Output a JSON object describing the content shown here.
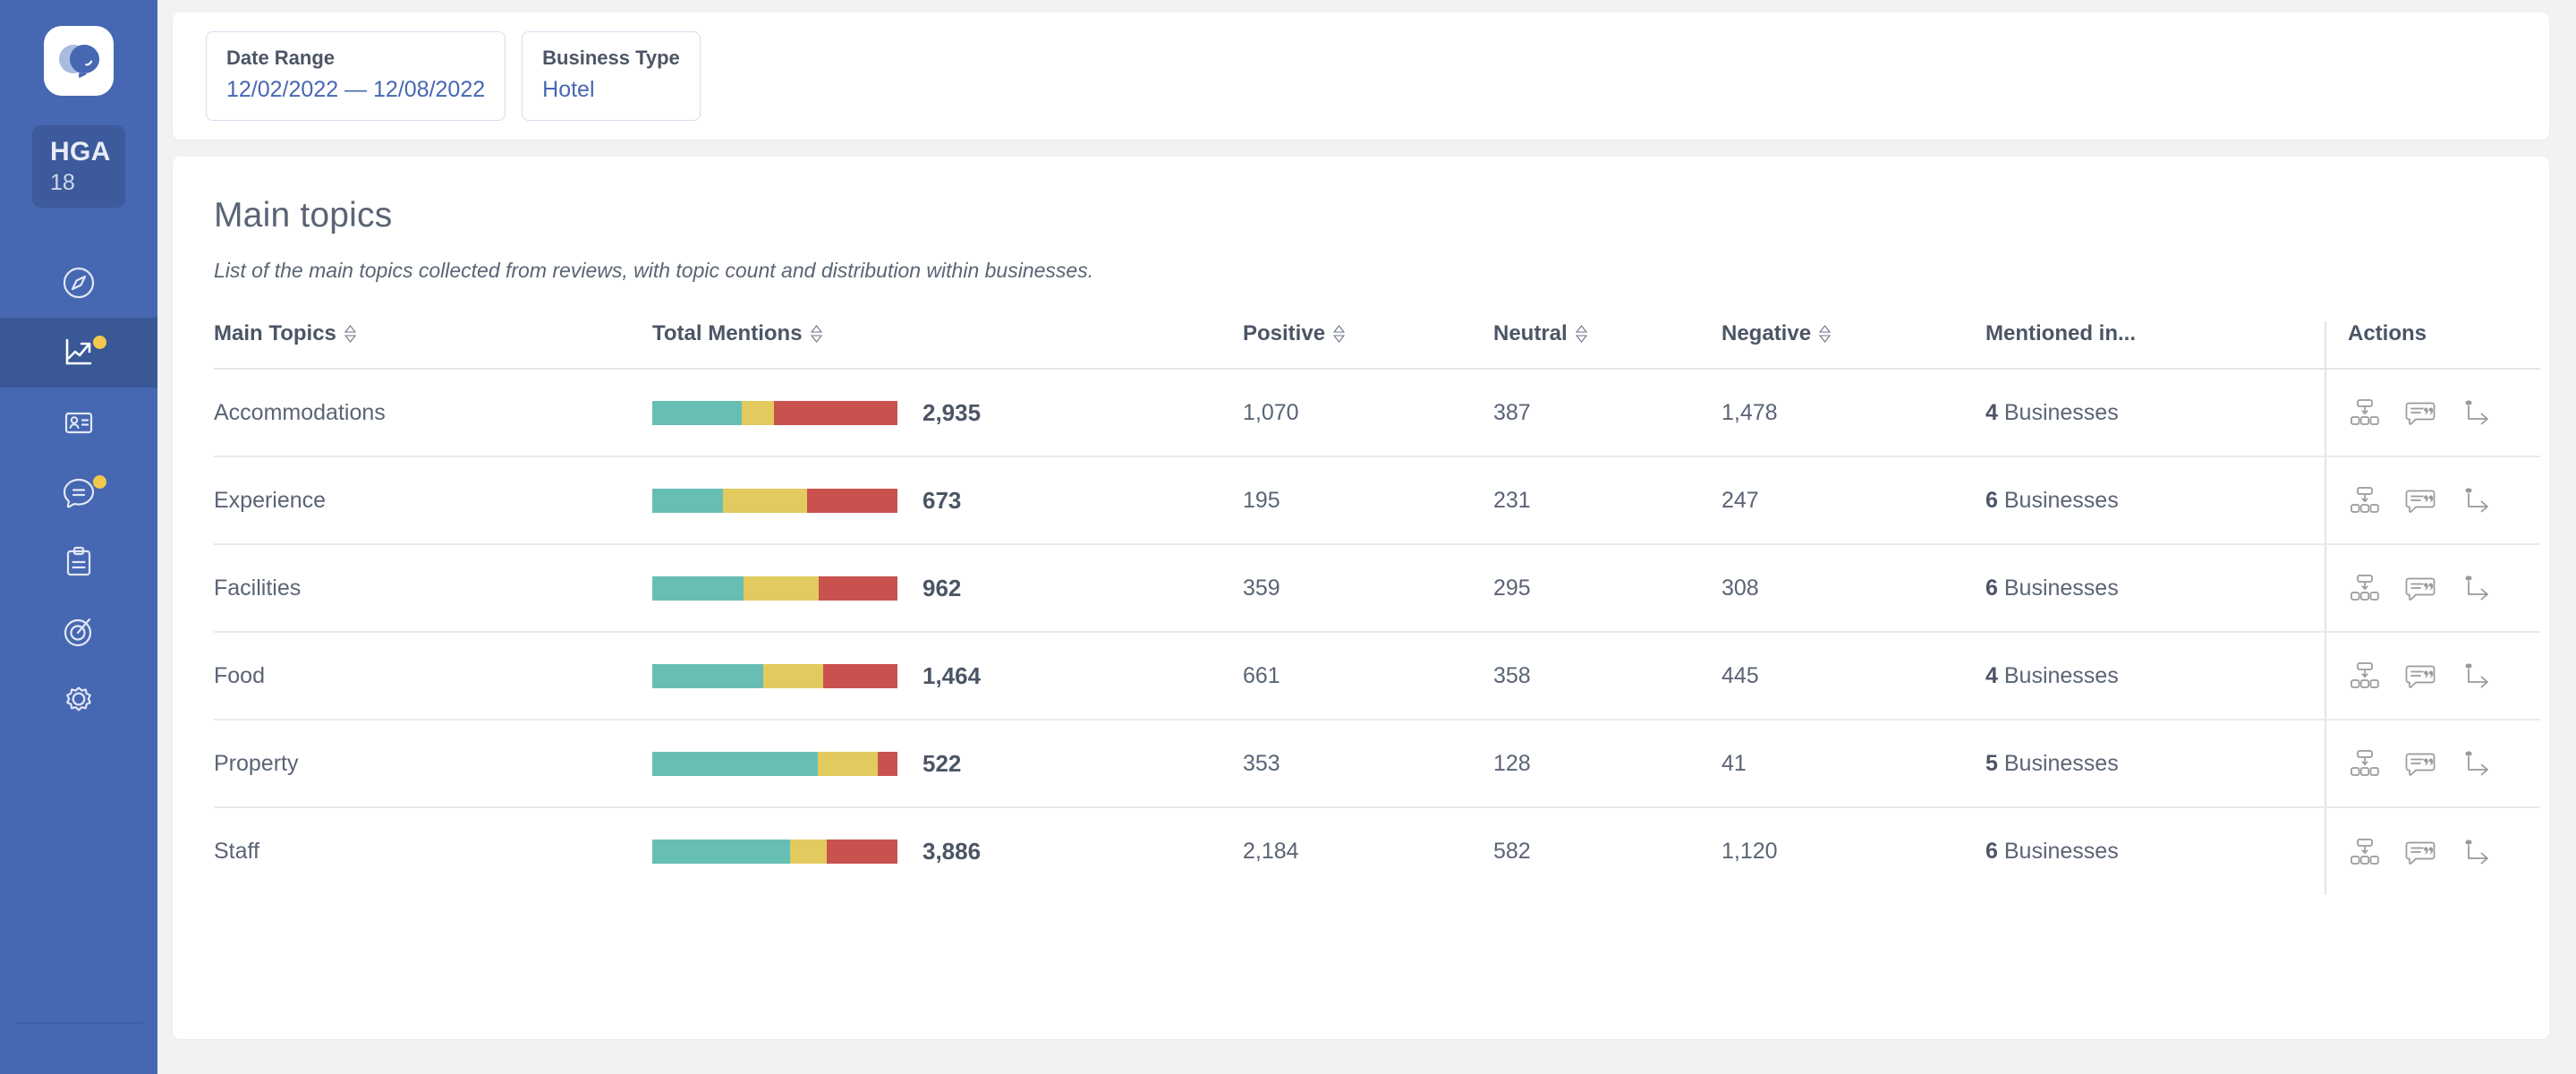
{
  "sidebar": {
    "logo_icon": "chat-bubbles-logo-icon",
    "org": {
      "code": "HGA",
      "count": "18"
    },
    "nav_items": [
      {
        "name": "sidebar-item-explore",
        "icon": "compass-icon",
        "active": false,
        "badge": false
      },
      {
        "name": "sidebar-item-analytics",
        "icon": "trend-chart-icon",
        "active": true,
        "badge": true
      },
      {
        "name": "sidebar-item-contacts",
        "icon": "contact-card-icon",
        "active": false,
        "badge": false
      },
      {
        "name": "sidebar-item-messages",
        "icon": "chat-bubble-icon",
        "active": false,
        "badge": true
      },
      {
        "name": "sidebar-item-reports",
        "icon": "clipboard-icon",
        "active": false,
        "badge": false
      },
      {
        "name": "sidebar-item-goals",
        "icon": "target-icon",
        "active": false,
        "badge": false
      },
      {
        "name": "sidebar-item-settings",
        "icon": "gear-icon",
        "active": false,
        "badge": false
      }
    ]
  },
  "filters": [
    {
      "name": "date-range-filter",
      "label": "Date Range",
      "value": "12/02/2022 — 12/08/2022"
    },
    {
      "name": "business-type-filter",
      "label": "Business Type",
      "value": "Hotel"
    }
  ],
  "main": {
    "title": "Main topics",
    "subtitle": "List of the main topics collected from reviews, with topic count and distribution within businesses."
  },
  "table": {
    "headers": [
      {
        "label": "Main Topics",
        "sortable": true
      },
      {
        "label": "Total Mentions",
        "sortable": true
      },
      {
        "label": "Positive",
        "sortable": true
      },
      {
        "label": "Neutral",
        "sortable": true
      },
      {
        "label": "Negative",
        "sortable": true
      },
      {
        "label": "Mentioned in...",
        "sortable": false
      },
      {
        "label": "Actions",
        "sortable": false
      }
    ],
    "businesses_word": "Businesses",
    "row_actions": [
      {
        "name": "drill-down-hierarchy-icon",
        "title": "Breakdown"
      },
      {
        "name": "quote-comment-icon",
        "title": "Reviews"
      },
      {
        "name": "redirect-arrow-icon",
        "title": "Go to"
      }
    ],
    "rows": [
      {
        "topic": "Accommodations",
        "total": "2,935",
        "positive": "1,070",
        "neutral": "387",
        "negative": "1,478",
        "businesses": "4"
      },
      {
        "topic": "Experience",
        "total": "673",
        "positive": "195",
        "neutral": "231",
        "negative": "247",
        "businesses": "6"
      },
      {
        "topic": "Facilities",
        "total": "962",
        "positive": "359",
        "neutral": "295",
        "negative": "308",
        "businesses": "6"
      },
      {
        "topic": "Food",
        "total": "1,464",
        "positive": "661",
        "neutral": "358",
        "negative": "445",
        "businesses": "4"
      },
      {
        "topic": "Property",
        "total": "522",
        "positive": "353",
        "neutral": "128",
        "negative": "41",
        "businesses": "5"
      },
      {
        "topic": "Staff",
        "total": "3,886",
        "positive": "2,184",
        "neutral": "582",
        "negative": "1,120",
        "businesses": "6"
      }
    ]
  },
  "chart_data": {
    "type": "bar",
    "title": "Main topics sentiment distribution",
    "stacked": true,
    "normalized": true,
    "categories": [
      "Accommodations",
      "Experience",
      "Facilities",
      "Food",
      "Property",
      "Staff"
    ],
    "series": [
      {
        "name": "Positive",
        "color": "#67bfb3",
        "values": [
          1070,
          195,
          359,
          661,
          353,
          2184
        ]
      },
      {
        "name": "Neutral",
        "color": "#e2ca5f",
        "values": [
          387,
          231,
          295,
          358,
          128,
          582
        ]
      },
      {
        "name": "Negative",
        "color": "#c9524f",
        "values": [
          1478,
          247,
          308,
          445,
          41,
          1120
        ]
      }
    ],
    "totals": [
      2935,
      673,
      962,
      1464,
      522,
      3886
    ],
    "xlabel": "",
    "ylabel": "Mentions",
    "legend_position": "none",
    "grid": false
  },
  "colors": {
    "sidebar": "#4667b2",
    "sidebar_active": "#3a5796",
    "accent": "#4667b2",
    "positive": "#67bfb3",
    "neutral": "#e2ca5f",
    "negative": "#c9524f",
    "badge": "#f2c94c",
    "page_bg": "#f2f2f3"
  }
}
